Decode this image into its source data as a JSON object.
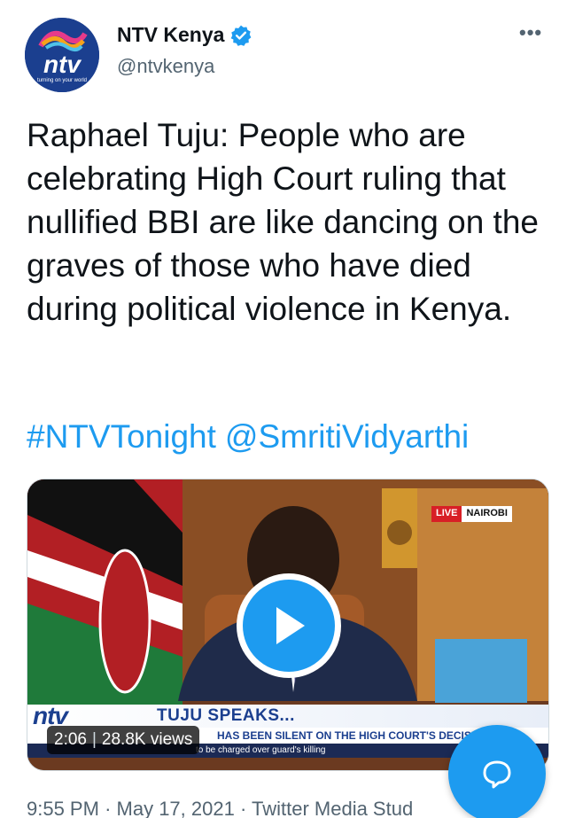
{
  "account": {
    "name": "NTV Kenya",
    "handle": "@ntvkenya",
    "avatar_brand": "ntv",
    "avatar_tagline": "turning on your world",
    "verified_icon": "verified-badge-icon"
  },
  "more_icon": "more-options-icon",
  "tweet": {
    "text": "Raphael Tuju: People who are celebrating High Court ruling that nullified BBI are like dancing on the graves of those who have died during political violence in Kenya.",
    "hashtags": [
      "#NTVTonight",
      "@SmritiVidyarthi"
    ]
  },
  "media": {
    "live_label": "LIVE",
    "location_label": "NAIROBI",
    "ticker_brand": "ntv",
    "ticker_headline": "TUJU SPEAKS...",
    "ticker_subline": "HAS BEEN SILENT ON THE HIGH COURT'S DECISION",
    "ticker_lower": "to be charged over guard's killing",
    "duration": "2:06",
    "views": "28.8K views",
    "play_icon": "play-icon"
  },
  "meta": {
    "time": "9:55 PM",
    "date": "May 17, 2021",
    "source": "Twitter Media Stud",
    "separator": "·"
  },
  "compose_icon": "compose-reply-icon",
  "colors": {
    "accent": "#1d9bf0",
    "secondary_text": "#536471",
    "brand_blue": "#1b3f8f",
    "live_red": "#d81f26"
  }
}
